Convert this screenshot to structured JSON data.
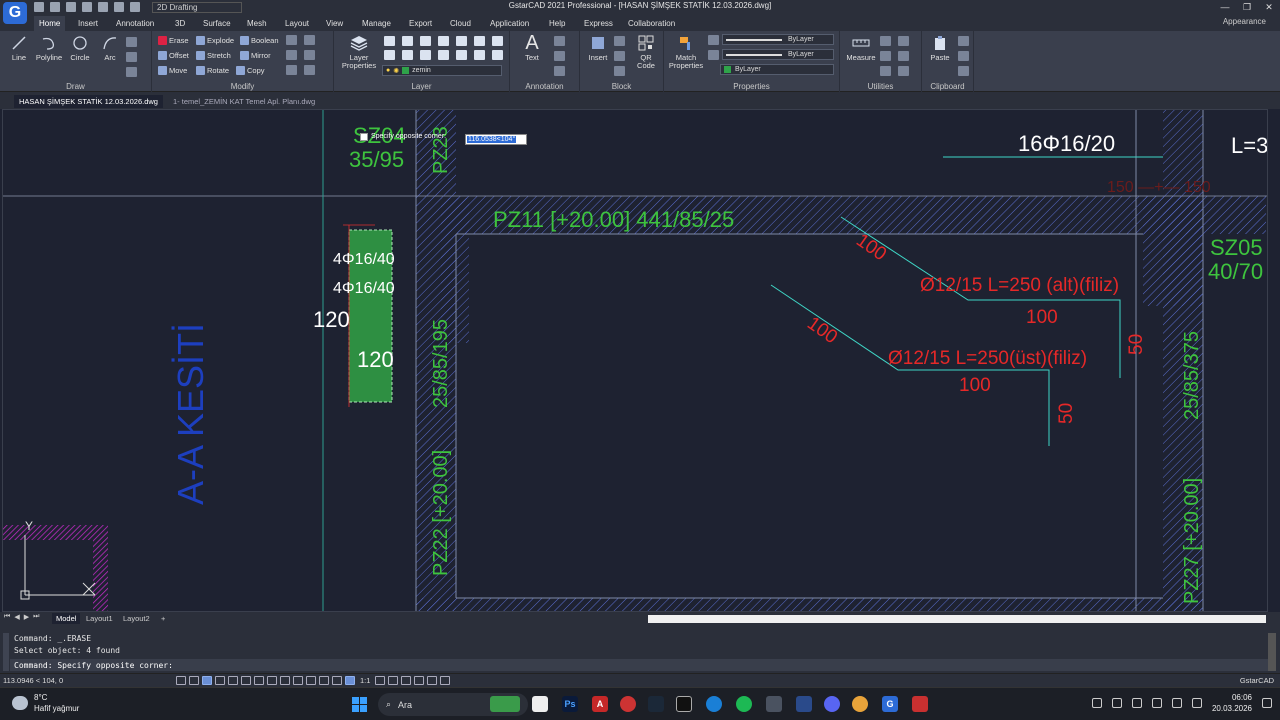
{
  "titlebar": {
    "app_logo": "G",
    "workspace": "2D Drafting",
    "window_title": "GstarCAD 2021 Professional - [HASAN ŞİMŞEK STATİK 12.03.2026.dwg]",
    "controls": [
      "—",
      "❐",
      "✕"
    ]
  },
  "ribbon": {
    "tabs": [
      "Home",
      "Insert",
      "Annotation",
      "3D",
      "Surface",
      "Mesh",
      "Layout",
      "View",
      "Manage",
      "Export",
      "Cloud",
      "Application",
      "Help",
      "Express",
      "Collaboration"
    ],
    "appearance": "Appearance",
    "draw": {
      "label": "Draw",
      "line": "Line",
      "polyline": "Polyline",
      "circle": "Circle",
      "arc": "Arc"
    },
    "modify": {
      "label": "Modify",
      "erase": "Erase",
      "explode": "Explode",
      "boolean": "Boolean",
      "offset": "Offset",
      "stretch": "Stretch",
      "mirror": "Mirror",
      "move": "Move",
      "rotate": "Rotate",
      "copy": "Copy"
    },
    "layer": {
      "label": "Layer",
      "layer_properties": "Layer Properties",
      "current_layer": "zemin"
    },
    "annotation": {
      "label": "Annotation",
      "text": "Text"
    },
    "block": {
      "label": "Block",
      "insert": "Insert",
      "qr_code": "QR Code"
    },
    "properties": {
      "label": "Properties",
      "match": "Match Properties",
      "color": "ByLayer",
      "linetype": "ByLayer",
      "layer_color": "ByLayer"
    },
    "utilities": {
      "label": "Utilities",
      "measure": "Measure"
    },
    "clipboard": {
      "label": "Clipboard",
      "paste": "Paste"
    }
  },
  "doc_tabs": [
    "HASAN ŞİMŞEK STATİK 12.03.2026.dwg",
    "1- temel_ZEMİN KAT Temel Apl. Planı.dwg"
  ],
  "drawing": {
    "sz04_name": "SZ04",
    "sz04_dim": "35/95",
    "pz23": "PZ23",
    "pz11": "PZ11 [+20.00]  441/85/25",
    "rebar_top": "16Φ16/20",
    "l_label": "L=3",
    "red_dim": "150 —+— 150",
    "sz05_name": "SZ05",
    "sz05_dim": "40/70",
    "rebar1": "4Φ16/40",
    "rebar2": "4Φ16/40",
    "dim120_a": "120",
    "dim120_b": "120",
    "section": "A-A KESİTİ",
    "pz22_dim": "25/85/195",
    "pz22": "PZ22 [+20.00]",
    "alt_rebar": "Ø12/15 L=250 (alt)(filiz)",
    "ust_rebar": "Ø12/15 L=250(üst)(filiz)",
    "d100_a": "100",
    "d100_b": "100",
    "d100_c": "100",
    "d100_d": "100",
    "d50_a": "50",
    "d50_b": "50",
    "pz27_dim": "25/85/375",
    "pz27": "PZ27 [+20.00]",
    "ucs_y": "Y"
  },
  "prompt": {
    "label": "Specify opposite corner:",
    "value": "116.0538<104°"
  },
  "layout_tabs": [
    "Model",
    "Layout1",
    "Layout2",
    "+"
  ],
  "command": {
    "history": [
      "Command:  _.ERASE",
      "Select object:  4 found",
      "Command: Specify opposite corner:"
    ]
  },
  "status": {
    "coords": "113.0946 < 104, 0",
    "scale": "1:1",
    "app": "GstarCAD"
  },
  "taskbar": {
    "temp": "8°C",
    "weather": "Hafif yağmur",
    "search": "Ara",
    "time": "06:06",
    "date": "20.03.2026"
  }
}
